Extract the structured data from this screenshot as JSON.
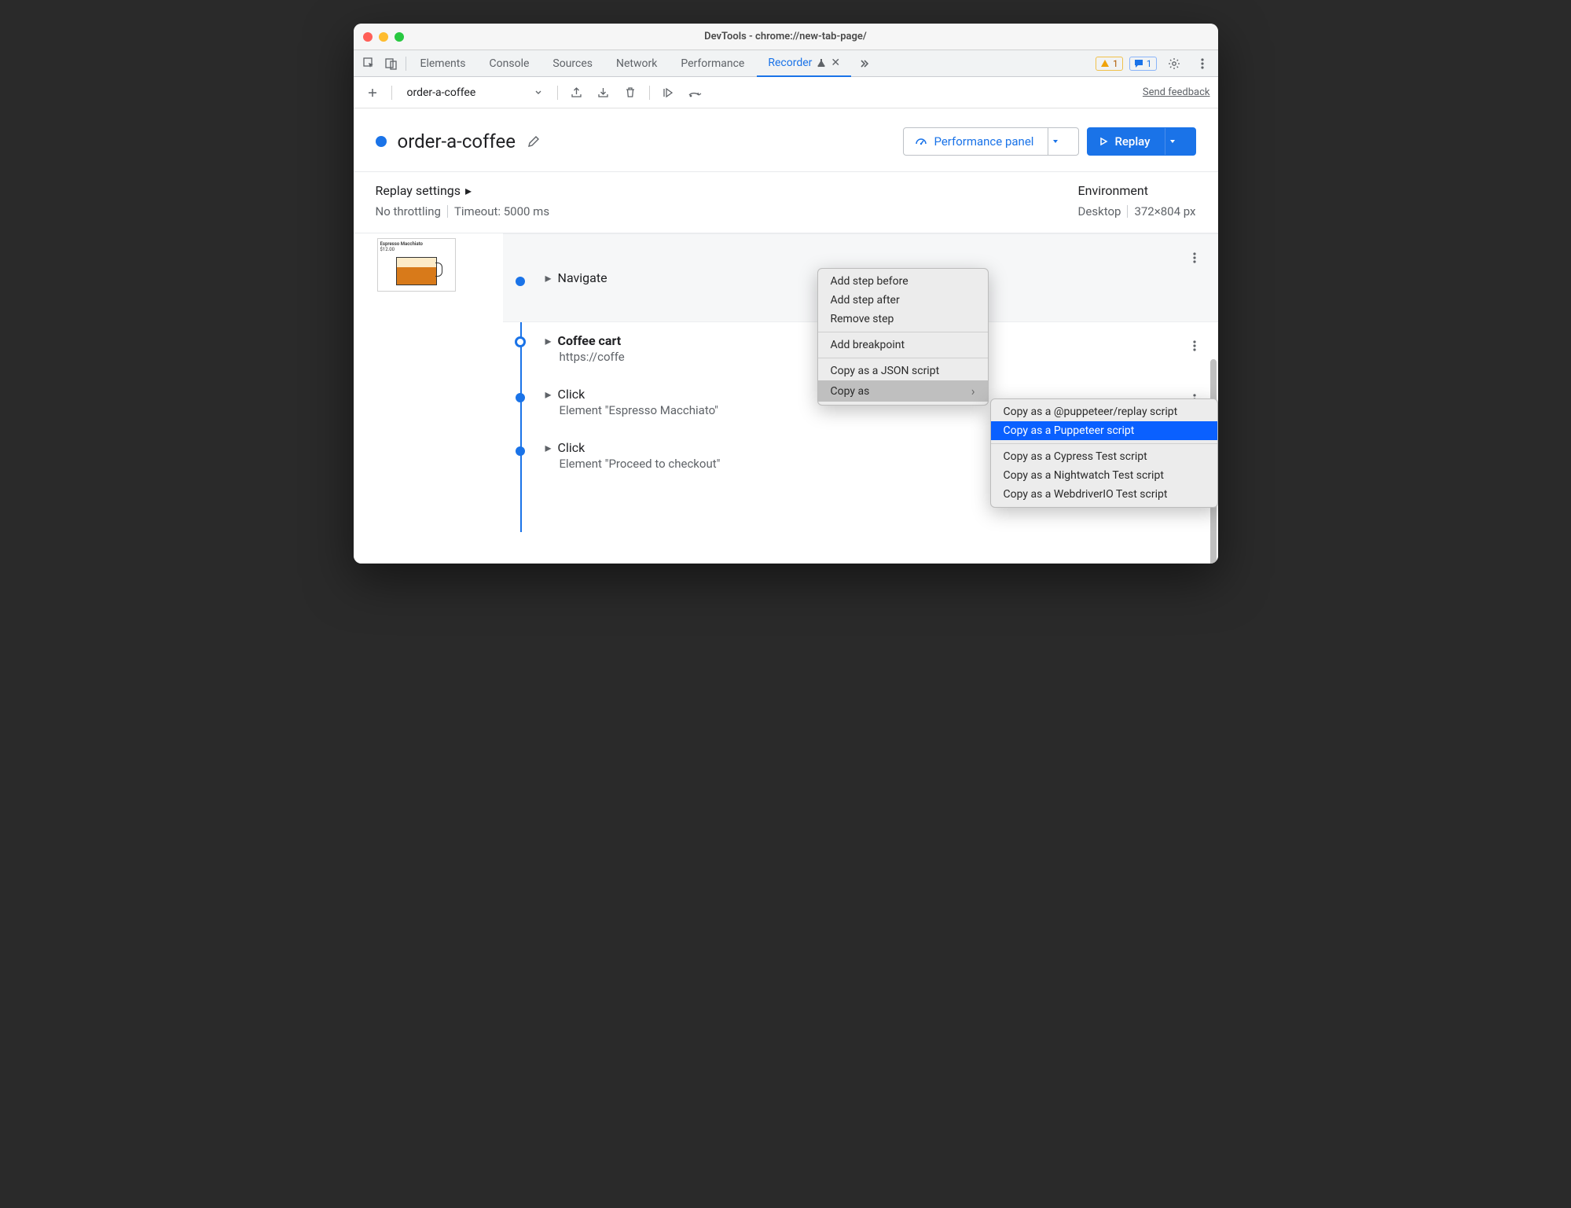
{
  "window": {
    "title": "DevTools - chrome://new-tab-page/"
  },
  "tabstrip": {
    "tabs": [
      "Elements",
      "Console",
      "Sources",
      "Network",
      "Performance"
    ],
    "recorder_tab": "Recorder",
    "warn_count": "1",
    "info_count": "1"
  },
  "toolbar": {
    "recording_name": "order-a-coffee",
    "feedback": "Send feedback"
  },
  "header": {
    "title": "order-a-coffee",
    "perf_btn": "Performance panel",
    "replay_btn": "Replay"
  },
  "settings": {
    "replay_heading": "Replay settings",
    "throttling": "No throttling",
    "timeout": "Timeout: 5000 ms",
    "env_heading": "Environment",
    "device": "Desktop",
    "dims": "372×804 px"
  },
  "steps": {
    "navigate": {
      "label": "Navigate"
    },
    "coffee": {
      "label": "Coffee cart",
      "sub": "https://coffe"
    },
    "click1": {
      "label": "Click",
      "sub": "Element \"Espresso Macchiato\""
    },
    "click2": {
      "label": "Click",
      "sub": "Element \"Proceed to checkout\""
    }
  },
  "thumb": {
    "title": "Espresso Macchiato",
    "price": "$12.00"
  },
  "menu1": {
    "add_before": "Add step before",
    "add_after": "Add step after",
    "remove": "Remove step",
    "breakpoint": "Add breakpoint",
    "copy_json": "Copy as a JSON script",
    "copy_as": "Copy as"
  },
  "menu2": {
    "replay": "Copy as a @puppeteer/replay script",
    "puppeteer": "Copy as a Puppeteer script",
    "cypress": "Copy as a Cypress Test script",
    "nightwatch": "Copy as a Nightwatch Test script",
    "webdriverio": "Copy as a WebdriverIO Test script"
  }
}
